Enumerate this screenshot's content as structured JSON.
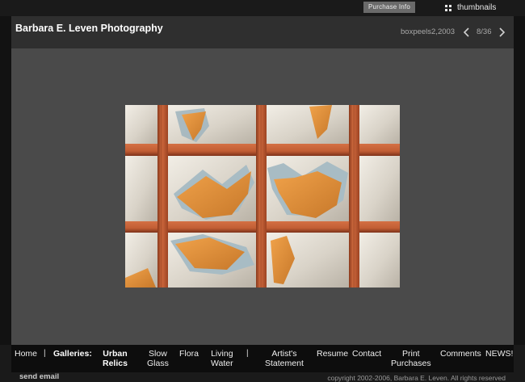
{
  "topbar": {
    "purchase_label": "Purchase Info",
    "thumbnails_label": "thumbnails",
    "thumbnails_icon": "grid-icon"
  },
  "header": {
    "site_title": "Barbara E. Leven Photography",
    "image_caption": "boxpeels2,2003",
    "prev_icon": "chevron-left-icon",
    "counter": "8/36",
    "next_icon": "chevron-right-icon"
  },
  "nav": {
    "home": "Home",
    "sep1": "|",
    "galleries_label": "Galleries:",
    "urban_relics": [
      "Urban",
      "Relics"
    ],
    "slow_glass": [
      "Slow",
      "Glass"
    ],
    "flora": "Flora",
    "living_water": [
      "Living",
      "Water"
    ],
    "sep2": "|",
    "artists_statement": [
      "Artist's",
      "Statement"
    ],
    "resume": "Resume",
    "contact": "Contact",
    "print_purchases": [
      "Print",
      "Purchases"
    ],
    "comments": "Comments",
    "news": "NEWS!"
  },
  "footer": {
    "send_email": "send email",
    "copyright": "copyright 2002-2006, Barbara E. Leven. All rights reserved"
  },
  "colors": {
    "page_bg": "#1a1a1a",
    "header_bg": "#2f2f2f",
    "stage_bg": "#4a4a4a",
    "nav_bg": "#0d0d0d",
    "purchase_bg": "#6a6a6a",
    "wood": "#c8623a"
  }
}
